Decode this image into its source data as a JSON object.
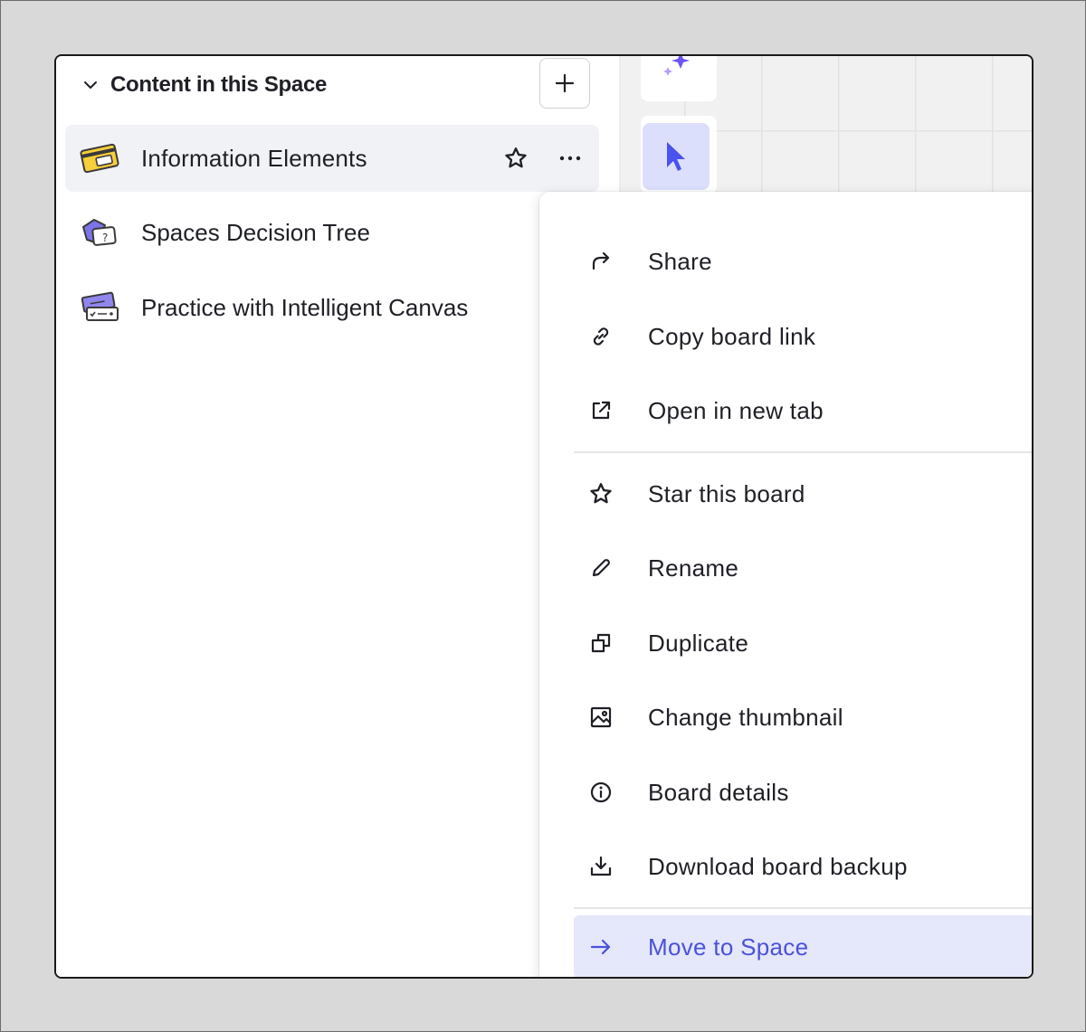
{
  "sidebar": {
    "section_title": "Content in this Space",
    "add_button_symbol": "+",
    "boards": [
      {
        "label": "Information Elements",
        "thumb": "id-card-thumbnail",
        "active": true
      },
      {
        "label": "Spaces Decision Tree",
        "thumb": "question-cards-thumbnail",
        "active": false
      },
      {
        "label": "Practice with Intelligent Canvas",
        "thumb": "tickets-thumbnail",
        "active": false
      }
    ],
    "more_symbol": "···"
  },
  "menu": {
    "items": [
      {
        "label": "Share",
        "icon": "share-arrow-icon"
      },
      {
        "label": "Copy board link",
        "icon": "link-icon"
      },
      {
        "label": "Open in new tab",
        "icon": "external-link-icon"
      },
      {
        "label": "Star this board",
        "icon": "star-icon"
      },
      {
        "label": "Rename",
        "icon": "pencil-icon"
      },
      {
        "label": "Duplicate",
        "icon": "duplicate-icon"
      },
      {
        "label": "Change thumbnail",
        "icon": "image-icon"
      },
      {
        "label": "Board details",
        "icon": "info-icon"
      },
      {
        "label": "Download board backup",
        "icon": "download-icon"
      },
      {
        "label": "Move to Space",
        "icon": "arrow-right-icon"
      }
    ]
  },
  "colors": {
    "accent": "#4a52d8",
    "selected_tool_bg": "#dcdffb",
    "highlight_bg": "#e5e7fb",
    "sparkle": "#7b61ff"
  }
}
